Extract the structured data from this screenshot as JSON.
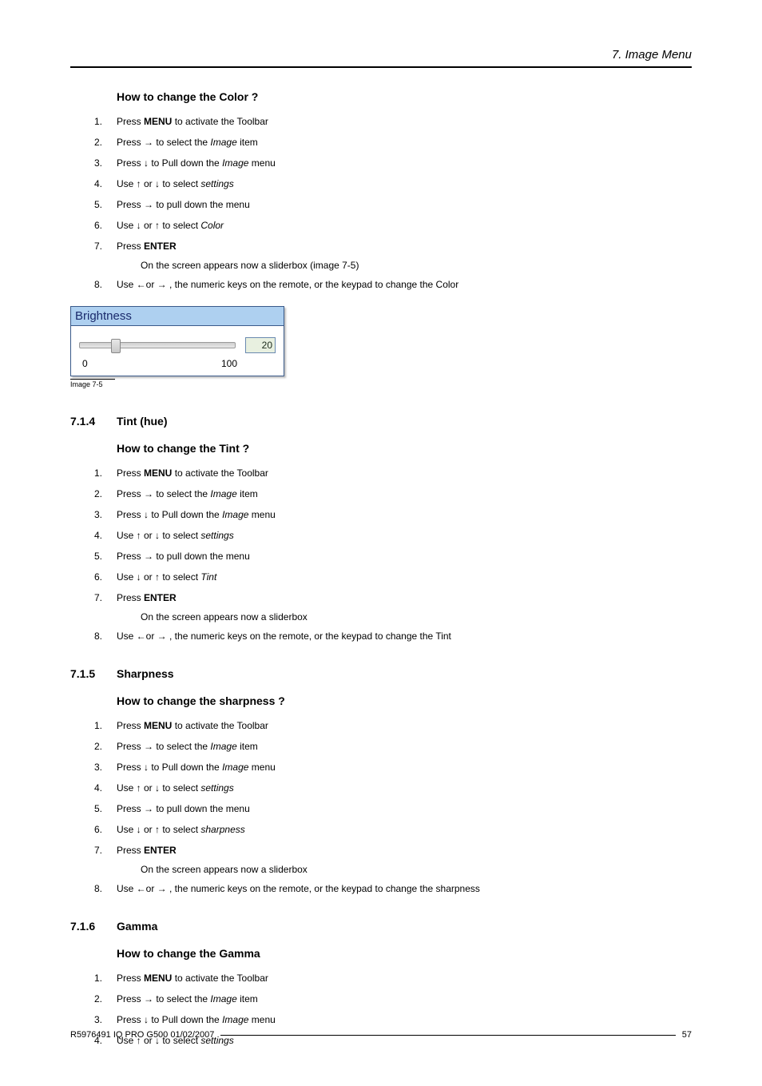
{
  "header": {
    "title": "7.  Image Menu"
  },
  "section_color": {
    "heading": "How to change the Color ?",
    "steps": [
      {
        "n": "1.",
        "parts": [
          "Press ",
          {
            "b": "MENU"
          },
          " to activate the Toolbar"
        ]
      },
      {
        "n": "2.",
        "parts": [
          "Press → to select the ",
          {
            "i": "Image"
          },
          " item"
        ]
      },
      {
        "n": "3.",
        "parts": [
          "Press ↓ to Pull down the ",
          {
            "i": "Image"
          },
          " menu"
        ]
      },
      {
        "n": "4.",
        "parts": [
          "Use ↑ or ↓ to select ",
          {
            "i": "settings"
          }
        ]
      },
      {
        "n": "5.",
        "parts": [
          "Press → to pull down the menu"
        ]
      },
      {
        "n": "6.",
        "parts": [
          "Use ↓ or ↑ to select ",
          {
            "i": "Color"
          }
        ]
      },
      {
        "n": "7.",
        "parts": [
          "Press ",
          {
            "b": "ENTER"
          }
        ],
        "sub": "On the screen appears now a sliderbox (image 7-5)"
      },
      {
        "n": "8.",
        "parts": [
          "Use ←or → , the numeric keys on the remote, or the keypad to change the Color"
        ]
      }
    ]
  },
  "sliderbox": {
    "title": "Brightness",
    "min": "0",
    "max": "100",
    "value": "20",
    "thumb_percent": 20,
    "caption": "Image 7-5"
  },
  "section_tint": {
    "num": "7.1.4",
    "title": "Tint (hue)",
    "heading": "How to change the Tint ?",
    "steps": [
      {
        "n": "1.",
        "parts": [
          "Press ",
          {
            "b": "MENU"
          },
          " to activate the Toolbar"
        ]
      },
      {
        "n": "2.",
        "parts": [
          "Press → to select the ",
          {
            "i": "Image"
          },
          " item"
        ]
      },
      {
        "n": "3.",
        "parts": [
          "Press ↓ to Pull down the ",
          {
            "i": "Image"
          },
          " menu"
        ]
      },
      {
        "n": "4.",
        "parts": [
          "Use ↑ or ↓ to select ",
          {
            "i": "settings"
          }
        ]
      },
      {
        "n": "5.",
        "parts": [
          "Press → to pull down the menu"
        ]
      },
      {
        "n": "6.",
        "parts": [
          "Use ↓ or ↑ to select ",
          {
            "i": "Tint"
          }
        ]
      },
      {
        "n": "7.",
        "parts": [
          "Press ",
          {
            "b": "ENTER"
          }
        ],
        "sub": "On the screen appears now a sliderbox"
      },
      {
        "n": "8.",
        "parts": [
          "Use ←or → , the numeric keys on the remote, or the keypad to change the Tint"
        ]
      }
    ]
  },
  "section_sharp": {
    "num": "7.1.5",
    "title": "Sharpness",
    "heading": "How to change the sharpness ?",
    "steps": [
      {
        "n": "1.",
        "parts": [
          "Press ",
          {
            "b": "MENU"
          },
          " to activate the Toolbar"
        ]
      },
      {
        "n": "2.",
        "parts": [
          "Press → to select the ",
          {
            "i": "Image"
          },
          " item"
        ]
      },
      {
        "n": "3.",
        "parts": [
          "Press ↓ to Pull down the ",
          {
            "i": "Image"
          },
          " menu"
        ]
      },
      {
        "n": "4.",
        "parts": [
          "Use ↑ or ↓ to select ",
          {
            "i": "settings"
          }
        ]
      },
      {
        "n": "5.",
        "parts": [
          "Press → to pull down the menu"
        ]
      },
      {
        "n": "6.",
        "parts": [
          "Use ↓ or ↑ to select ",
          {
            "i": "sharpness"
          }
        ]
      },
      {
        "n": "7.",
        "parts": [
          "Press ",
          {
            "b": "ENTER"
          }
        ],
        "sub": "On the screen appears now a sliderbox"
      },
      {
        "n": "8.",
        "parts": [
          "Use ←or → , the numeric keys on the remote, or the keypad to change the sharpness"
        ]
      }
    ]
  },
  "section_gamma": {
    "num": "7.1.6",
    "title": "Gamma",
    "heading": "How to change the Gamma",
    "steps": [
      {
        "n": "1.",
        "parts": [
          "Press ",
          {
            "b": "MENU"
          },
          " to activate the Toolbar"
        ]
      },
      {
        "n": "2.",
        "parts": [
          "Press → to select the ",
          {
            "i": "Image"
          },
          " item"
        ]
      },
      {
        "n": "3.",
        "parts": [
          "Press ↓ to Pull down the ",
          {
            "i": "Image"
          },
          " menu"
        ]
      },
      {
        "n": "4.",
        "parts": [
          "Use ↑ or ↓ to select ",
          {
            "i": "settings"
          }
        ]
      }
    ]
  },
  "footer": {
    "left": "R5976491  IQ PRO G500  01/02/2007",
    "right": "57"
  }
}
